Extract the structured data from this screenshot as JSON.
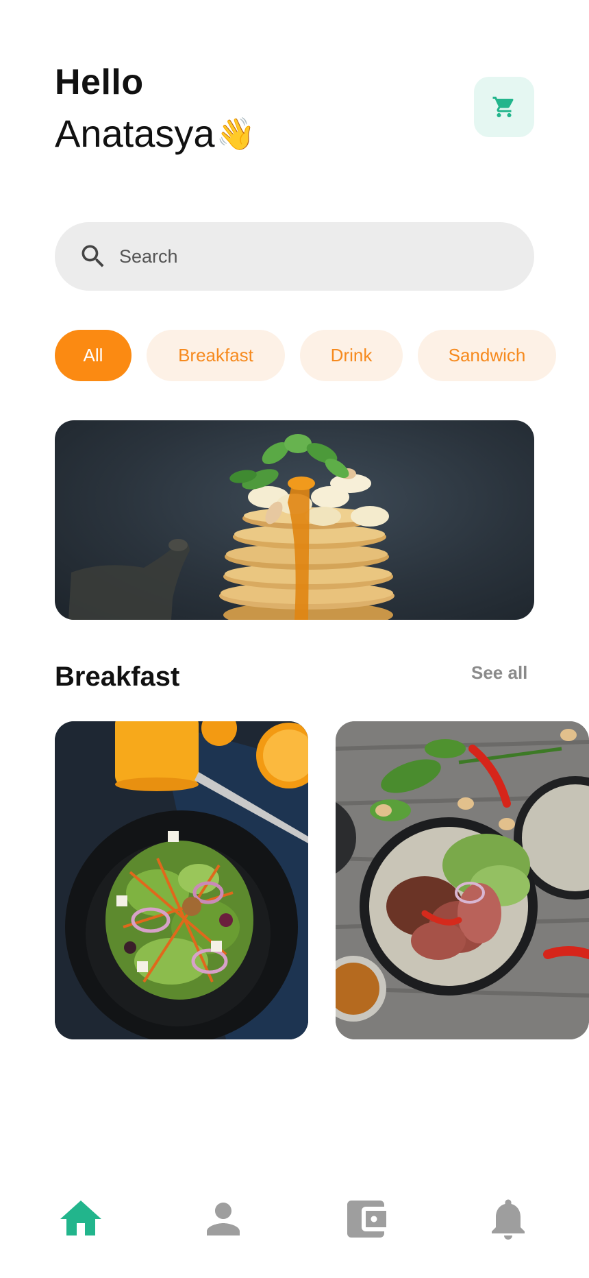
{
  "header": {
    "greeting": "Hello",
    "user_name": "Anatasya",
    "wave_emoji": "👋",
    "cart_icon": "cart-icon"
  },
  "search": {
    "placeholder": "Search",
    "icon": "search-icon"
  },
  "categories": [
    {
      "label": "All",
      "active": true
    },
    {
      "label": "Breakfast",
      "active": false
    },
    {
      "label": "Drink",
      "active": false
    },
    {
      "label": "Sandwich",
      "active": false
    }
  ],
  "hero": {
    "image": "pancake-stack-photo"
  },
  "section": {
    "title": "Breakfast",
    "see_all": "See all"
  },
  "cards": [
    {
      "image": "salad-bowl-photo"
    },
    {
      "image": "steak-plate-photo"
    }
  ],
  "nav": [
    {
      "icon": "home-icon",
      "active": true
    },
    {
      "icon": "profile-icon",
      "active": false
    },
    {
      "icon": "wallet-icon",
      "active": false
    },
    {
      "icon": "bell-icon",
      "active": false
    }
  ],
  "colors": {
    "accent_orange": "#fb8a12",
    "chip_bg": "#fdf1e6",
    "accent_green": "#22b58c",
    "cart_bg": "#e5f7f2",
    "nav_inactive": "#9e9e9e"
  }
}
